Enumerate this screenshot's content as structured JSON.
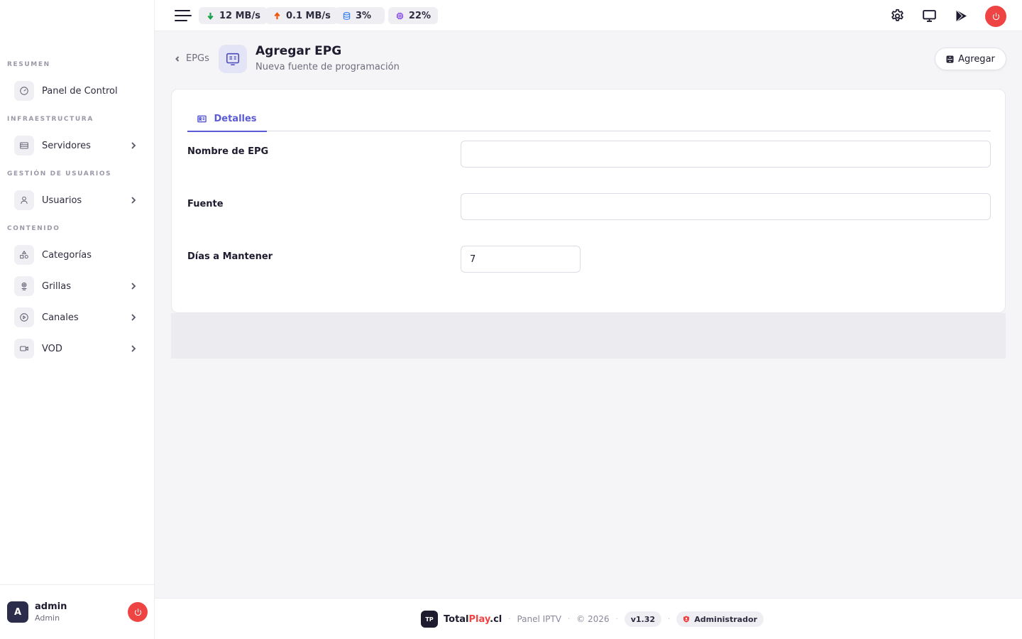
{
  "sidebar": {
    "sections": [
      {
        "title": "RESUMEN"
      },
      {
        "title": "INFRAESTRUCTURA"
      },
      {
        "title": "GESTIÓN DE USUARIOS"
      },
      {
        "title": "CONTENIDO"
      }
    ],
    "items": [
      {
        "label": "Panel de Control",
        "icon": "dashboard-icon"
      },
      {
        "label": "Servidores",
        "icon": "server-icon"
      },
      {
        "label": "Usuarios",
        "icon": "user-icon"
      },
      {
        "label": "Categorías",
        "icon": "shapes-icon"
      },
      {
        "label": "Grillas",
        "icon": "grid-icon"
      },
      {
        "label": "Canales",
        "icon": "play-circle-icon"
      },
      {
        "label": "VOD",
        "icon": "video-icon"
      }
    ],
    "user": {
      "initial": "A",
      "name": "admin",
      "role": "Admin"
    }
  },
  "topbar": {
    "download": "12 MB/s",
    "upload": "0.1 MB/s",
    "disk": "3%",
    "cpu": "22%",
    "colors": {
      "download": "#16a34a",
      "upload": "#ea580c",
      "disk": "#3b82f6",
      "cpu": "#7c3aed",
      "danger": "#ef4444"
    }
  },
  "header": {
    "back_label": "EPGs",
    "title": "Agregar EPG",
    "subtitle": "Nueva fuente de programación",
    "add_button": "Agregar"
  },
  "form": {
    "tab_label": "Detalles",
    "fields": [
      {
        "label": "Nombre de EPG",
        "value": ""
      },
      {
        "label": "Fuente",
        "value": ""
      },
      {
        "label": "Días a Mantener",
        "value": "7"
      }
    ]
  },
  "footer": {
    "logo": "TP",
    "brand_prefix": "Total",
    "brand_accent": "Play",
    "brand_suffix": ".cl",
    "panel": "Panel IPTV",
    "copyright": "© 2026",
    "version": "v1.32",
    "role": "Administrador",
    "accent_color": "#ef4444"
  }
}
